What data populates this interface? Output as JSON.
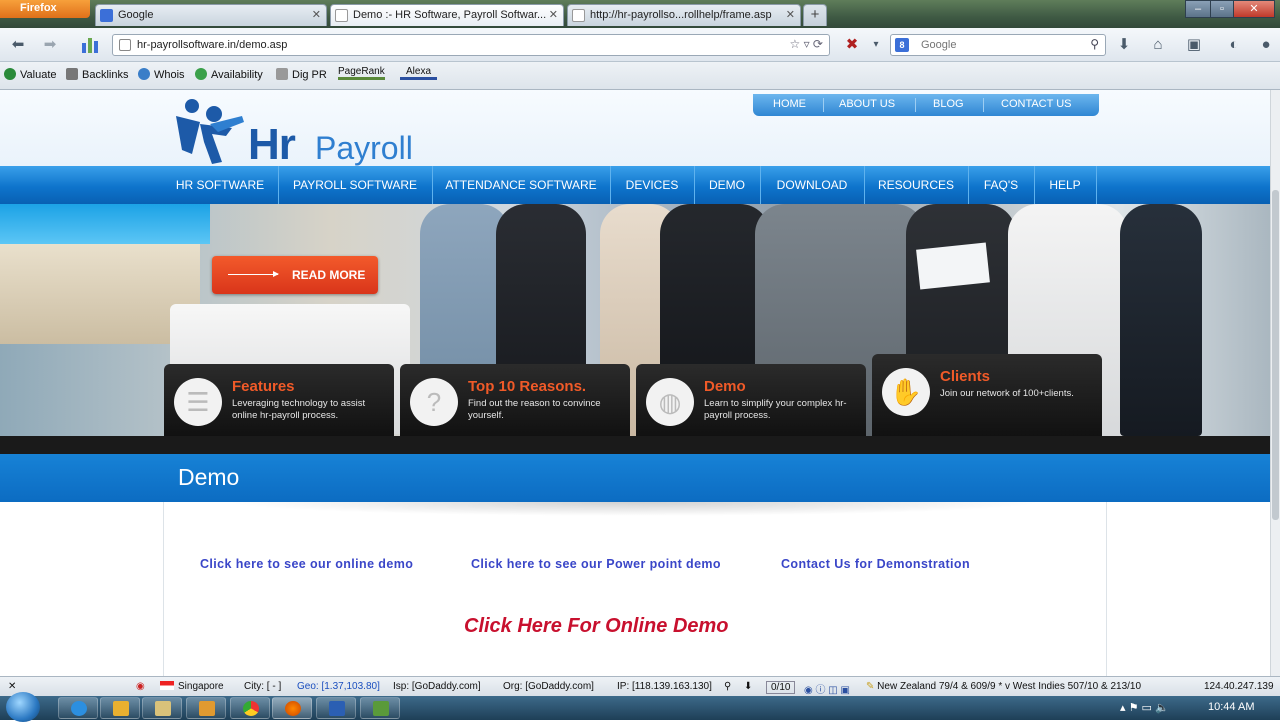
{
  "browser": {
    "app_button": "Firefox",
    "tabs": [
      {
        "label": "Google",
        "active": false
      },
      {
        "label": "Demo :- HR Software, Payroll Softwar...",
        "active": true
      },
      {
        "label": "http://hr-payrollso...rollhelp/frame.asp",
        "active": false
      }
    ],
    "url": "hr-payrollsoftware.in/demo.asp",
    "search_placeholder": "Google",
    "bookmarks": [
      "Valuate",
      "Backlinks",
      "Whois",
      "Availability",
      "Dig PR",
      "PageRank",
      "Alexa"
    ]
  },
  "site": {
    "logo": {
      "hr": "Hr",
      "payroll": "Payroll"
    },
    "top_nav": [
      "HOME",
      "ABOUT US",
      "BLOG",
      "CONTACT US"
    ],
    "main_nav": [
      "HR SOFTWARE",
      "PAYROLL SOFTWARE",
      "ATTENDANCE SOFTWARE",
      "DEVICES",
      "DEMO",
      "DOWNLOAD",
      "RESOURCES",
      "FAQ'S",
      "HELP"
    ],
    "hero": {
      "read_more": "READ MORE"
    },
    "features": [
      {
        "title": "Features",
        "desc": "Leveraging technology to assist online hr-payroll process.",
        "icon": "list-icon"
      },
      {
        "title": "Top 10 Reasons.",
        "desc": "Find out the reason to convince yourself.",
        "icon": "question-icon"
      },
      {
        "title": "Demo",
        "desc": "Learn to simplify your complex hr-payroll process.",
        "icon": "globe-icon"
      },
      {
        "title": "Clients",
        "desc": "Join our network of 100+clients.",
        "icon": "handshake-icon"
      }
    ],
    "section_title": "Demo",
    "demo_links": [
      "Click here to see our online demo",
      "Click here to see our Power point demo",
      "Contact Us for Demonstration"
    ],
    "big_link": "Click Here For Online Demo"
  },
  "status_bar": {
    "country": "Singapore",
    "city": "City: [ - ]",
    "geo": "Geo: [1.37,103.80]",
    "isp": "Isp: [GoDaddy.com]",
    "org": "Org: [GoDaddy.com]",
    "ip": "IP: [118.139.163.130]",
    "counter": "0/10",
    "score": "New Zealand 79/4 & 609/9 * v West Indies 507/10 & 213/10",
    "ip_right": "124.40.247.139"
  },
  "taskbar": {
    "clock": "10:44 AM"
  },
  "colors": {
    "brand_blue": "#0e74cc",
    "accent_orange": "#f05a28",
    "link_blue": "#3a46c8",
    "link_red": "#c8102e"
  }
}
